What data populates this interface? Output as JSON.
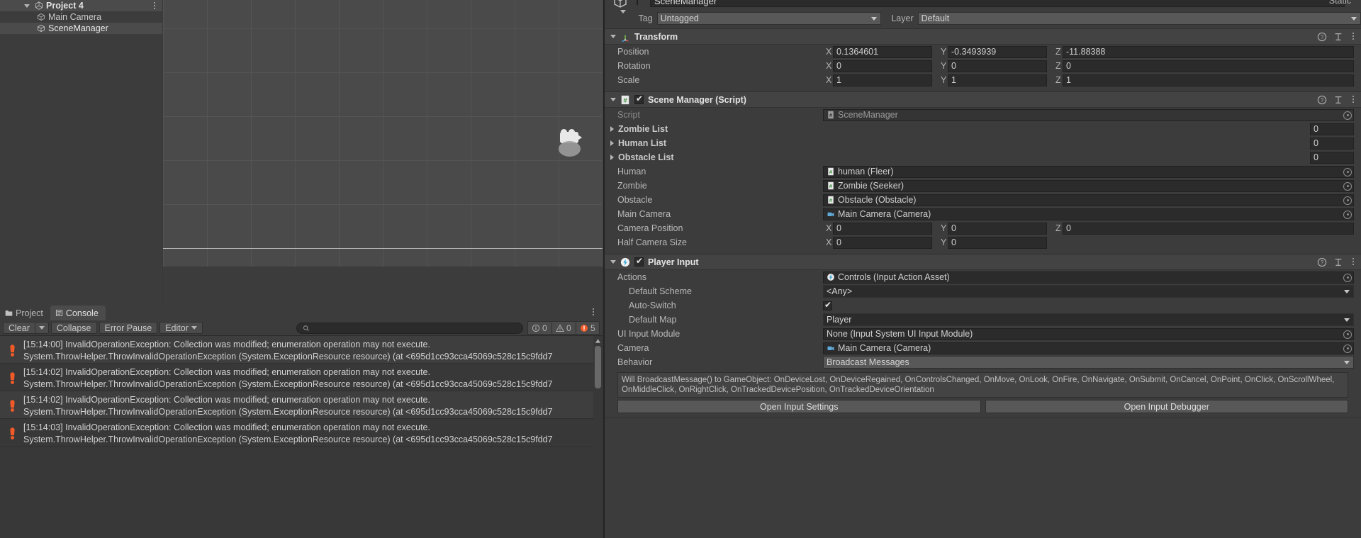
{
  "hierarchy": {
    "root": {
      "label": "Project 4",
      "icon": "unity-icon"
    },
    "items": [
      {
        "label": "Main Camera",
        "icon": "cube-icon",
        "selected": false
      },
      {
        "label": "SceneManager",
        "icon": "cube-icon",
        "selected": true
      }
    ],
    "menu_icon": "kebab-menu-icon"
  },
  "scene": {
    "gizmo": "camera-gizmo-icon"
  },
  "console": {
    "tabs": [
      {
        "label": "Project",
        "icon": "folder-icon",
        "active": false
      },
      {
        "label": "Console",
        "icon": "console-icon",
        "active": true
      }
    ],
    "toolbar": {
      "clear": "Clear",
      "collapse": "Collapse",
      "error_pause": "Error Pause",
      "editor": "Editor",
      "search_placeholder": ""
    },
    "counters": {
      "info": "0",
      "warning": "0",
      "error": "5"
    },
    "error_color": "#f05a28",
    "logs": [
      {
        "time": "[15:14:00]",
        "message": "InvalidOperationException: Collection was modified; enumeration operation may not execute.",
        "detail": "System.ThrowHelper.ThrowInvalidOperationException (System.ExceptionResource resource) (at <695d1cc93cca45069c528c15c9fdd7",
        "type": "error"
      },
      {
        "time": "[15:14:02]",
        "message": "InvalidOperationException: Collection was modified; enumeration operation may not execute.",
        "detail": "System.ThrowHelper.ThrowInvalidOperationException (System.ExceptionResource resource) (at <695d1cc93cca45069c528c15c9fdd7",
        "type": "error"
      },
      {
        "time": "[15:14:02]",
        "message": "InvalidOperationException: Collection was modified; enumeration operation may not execute.",
        "detail": "System.ThrowHelper.ThrowInvalidOperationException (System.ExceptionResource resource) (at <695d1cc93cca45069c528c15c9fdd7",
        "type": "error"
      },
      {
        "time": "[15:14:03]",
        "message": "InvalidOperationException: Collection was modified; enumeration operation may not execute.",
        "detail": "System.ThrowHelper.ThrowInvalidOperationException (System.ExceptionResource resource) (at <695d1cc93cca45069c528c15c9fdd7",
        "type": "error"
      }
    ]
  },
  "inspector": {
    "gameobject": {
      "name": "SceneManager",
      "enabled": true,
      "static_label": "Static"
    },
    "tag": {
      "label": "Tag",
      "value": "Untagged"
    },
    "layer": {
      "label": "Layer",
      "value": "Default"
    },
    "transform": {
      "title": "Transform",
      "rows": [
        {
          "name": "Position",
          "x": "0.1364601",
          "y": "-0.3493939",
          "z": "-11.88388"
        },
        {
          "name": "Rotation",
          "x": "0",
          "y": "0",
          "z": "0"
        },
        {
          "name": "Scale",
          "x": "1",
          "y": "1",
          "z": "1"
        }
      ],
      "axis_labels": [
        "X",
        "Y",
        "Z"
      ]
    },
    "scene_manager": {
      "title": "Scene Manager (Script)",
      "enabled": true,
      "script": {
        "label": "Script",
        "value": "SceneManager"
      },
      "lists": [
        {
          "label": "Zombie List",
          "count": "0"
        },
        {
          "label": "Human List",
          "count": "0"
        },
        {
          "label": "Obstacle List",
          "count": "0"
        }
      ],
      "refs": [
        {
          "label": "Human",
          "value": "human (Fleer)",
          "icon": "script-icon"
        },
        {
          "label": "Zombie",
          "value": "Zombie (Seeker)",
          "icon": "script-icon"
        },
        {
          "label": "Obstacle",
          "value": "Obstacle (Obstacle)",
          "icon": "script-icon"
        },
        {
          "label": "Main Camera",
          "value": "Main Camera (Camera)",
          "icon": "camera-icon"
        }
      ],
      "vectors": [
        {
          "name": "Camera Position",
          "x": "0",
          "y": "0",
          "z": "0"
        },
        {
          "name": "Half Camera Size",
          "x": "0",
          "y": "0"
        }
      ]
    },
    "player_input": {
      "title": "Player Input",
      "enabled": true,
      "actions": {
        "label": "Actions",
        "value": "Controls (Input Action Asset)",
        "icon": "input-action-icon"
      },
      "default_scheme": {
        "label": "Default Scheme",
        "value": "<Any>"
      },
      "auto_switch": {
        "label": "Auto-Switch",
        "checked": true
      },
      "default_map": {
        "label": "Default Map",
        "value": "Player"
      },
      "ui_input_module": {
        "label": "UI Input Module",
        "value": "None (Input System UI Input Module)"
      },
      "camera": {
        "label": "Camera",
        "value": "Main Camera (Camera)",
        "icon": "camera-icon"
      },
      "behavior": {
        "label": "Behavior",
        "value": "Broadcast Messages"
      },
      "help_text": "Will BroadcastMessage() to GameObject: OnDeviceLost, OnDeviceRegained, OnControlsChanged, OnMove, OnLook, OnFire, OnNavigate, OnSubmit, OnCancel, OnPoint, OnClick, OnScrollWheel, OnMiddleClick, OnRightClick, OnTrackedDevicePosition, OnTrackedDeviceOrientation",
      "buttons": {
        "settings": "Open Input Settings",
        "debugger": "Open Input Debugger"
      }
    }
  }
}
